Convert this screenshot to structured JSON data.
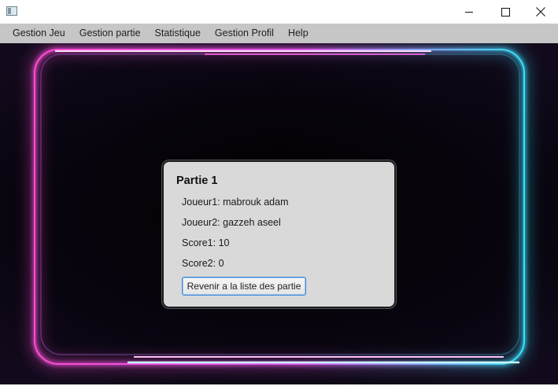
{
  "window": {
    "icons": {
      "app": "app-window-icon",
      "minimize": "minimize-icon",
      "maximize": "maximize-icon",
      "close": "close-icon"
    }
  },
  "menubar": {
    "items": [
      {
        "label": "Gestion Jeu"
      },
      {
        "label": "Gestion partie"
      },
      {
        "label": "Statistique"
      },
      {
        "label": "Gestion Profil"
      },
      {
        "label": "Help"
      }
    ]
  },
  "card": {
    "title": "Partie 1",
    "player1_label": "Joueur1:",
    "player1_value": "mabrouk adam",
    "player2_label": "Joueur2:",
    "player2_value": "gazzeh aseel",
    "score1_label": "Score1:",
    "score1_value": "10",
    "score2_label": "Score2:",
    "score2_value": "0",
    "back_button_label": "Revenir a la liste des partie"
  },
  "colors": {
    "neon_pink": "#ff4fd8",
    "neon_cyan": "#38e6ff",
    "menubar_bg": "#c6c6c6",
    "card_bg": "#d9d9d9",
    "button_focus": "#3c86d6"
  }
}
